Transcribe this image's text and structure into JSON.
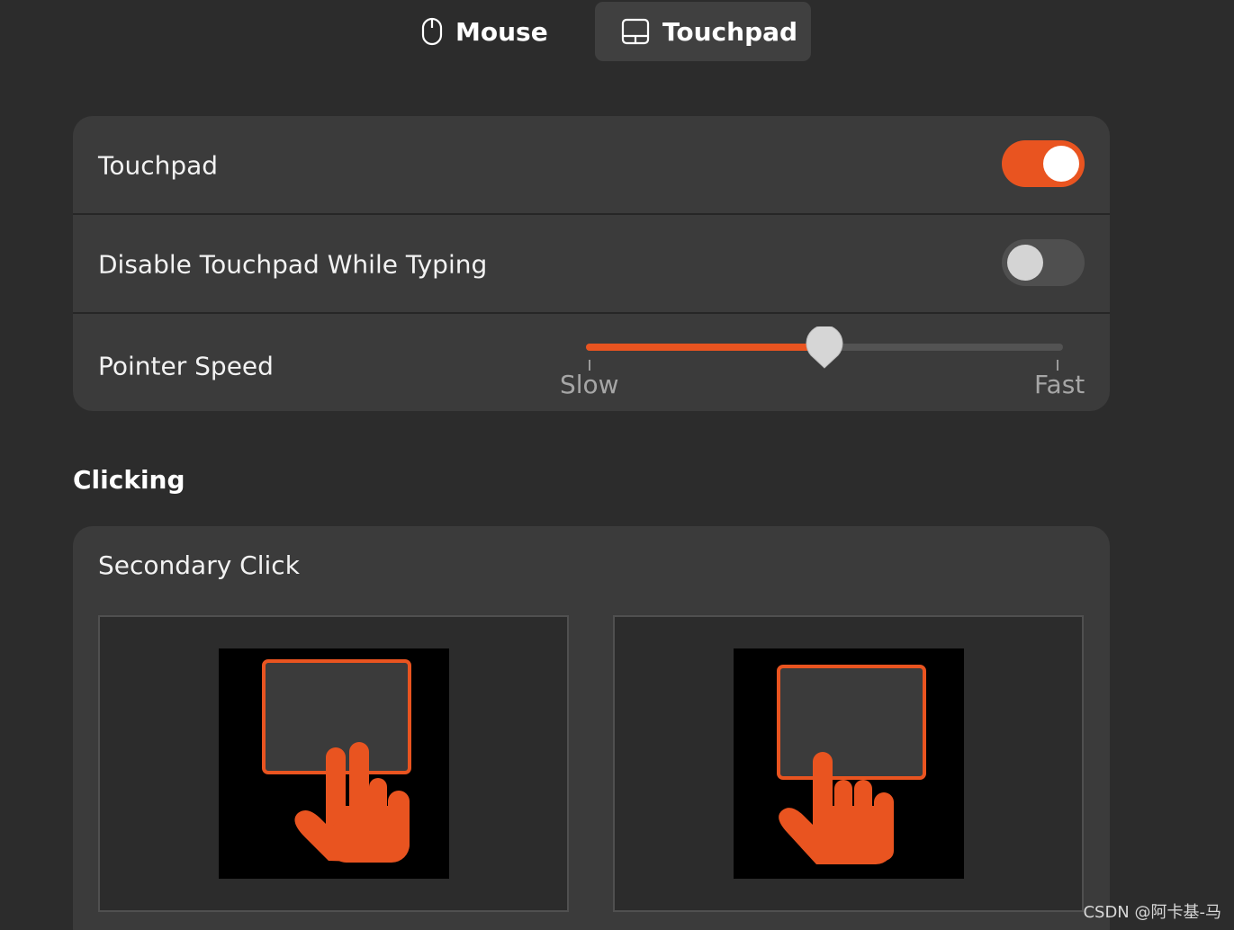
{
  "tabs": [
    {
      "label": "Mouse",
      "icon": "mouse-icon",
      "selected": false
    },
    {
      "label": "Touchpad",
      "icon": "touchpad-icon",
      "selected": true
    }
  ],
  "settings": {
    "touchpad": {
      "label": "Touchpad",
      "enabled": true
    },
    "disable_while_typing": {
      "label": "Disable Touchpad While Typing",
      "enabled": false
    },
    "pointer_speed": {
      "label": "Pointer Speed",
      "value": 0.5,
      "min_label": "Slow",
      "max_label": "Fast"
    }
  },
  "clicking": {
    "heading": "Clicking",
    "secondary_click": {
      "label": "Secondary Click",
      "options": [
        {
          "name": "two-finger-click",
          "icon": "two-finger-touchpad-icon"
        },
        {
          "name": "corner-click",
          "icon": "corner-touchpad-icon"
        }
      ]
    }
  },
  "watermark": "CSDN @阿卡基-马",
  "colors": {
    "accent": "#e95420",
    "background": "#2c2c2c",
    "card": "#3b3b3b"
  }
}
